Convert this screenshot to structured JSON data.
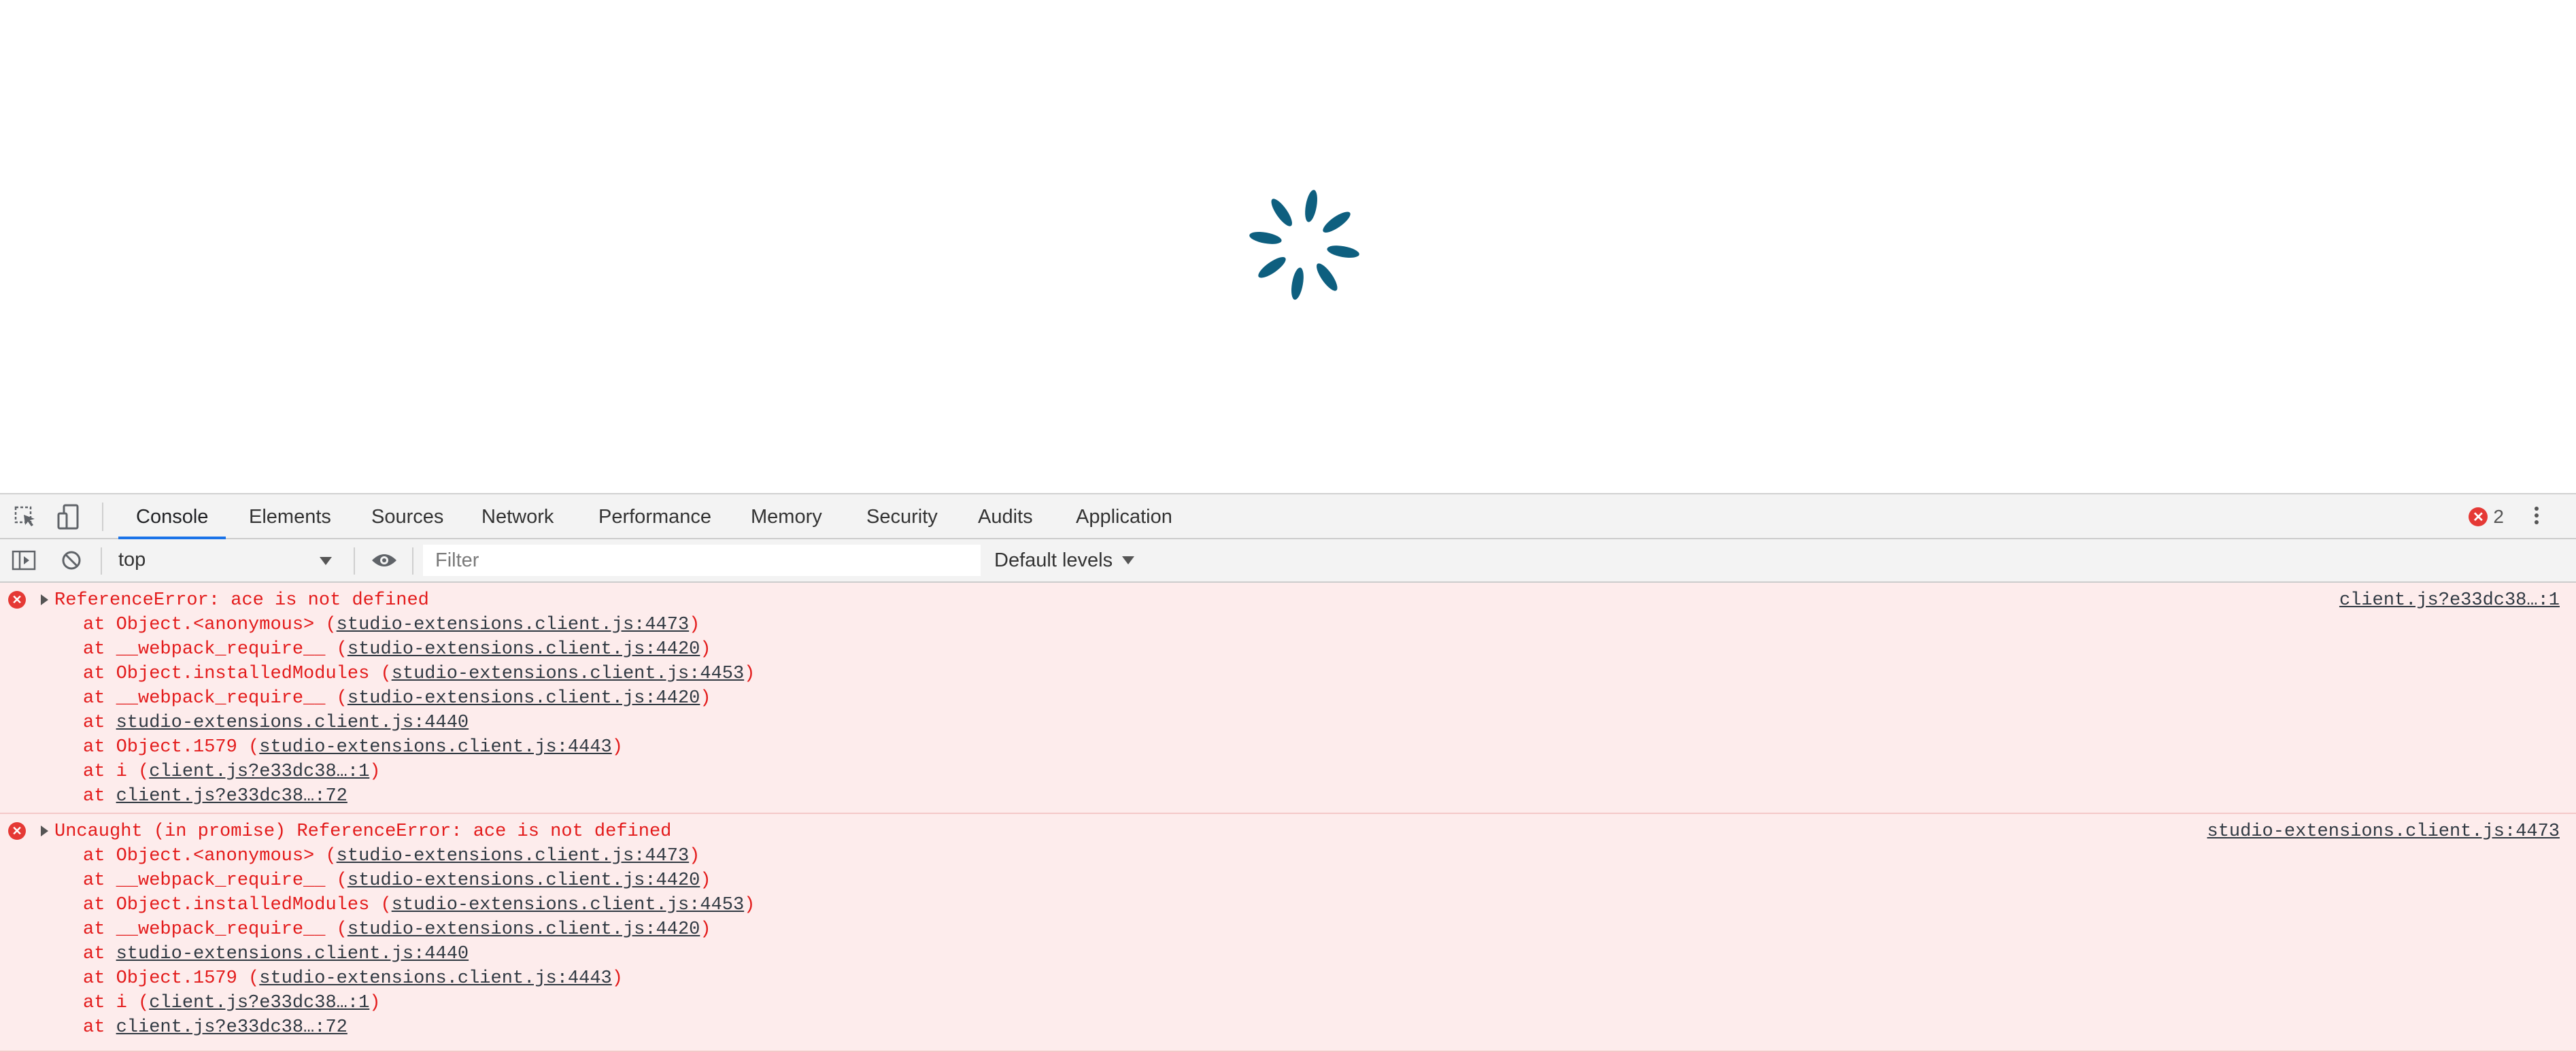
{
  "devtools": {
    "tabs": [
      "Console",
      "Elements",
      "Sources",
      "Network",
      "Performance",
      "Memory",
      "Security",
      "Audits",
      "Application"
    ],
    "error_count": "2",
    "toolbar": {
      "context": "top",
      "filter_placeholder": "Filter",
      "levels": "Default levels"
    }
  },
  "console": {
    "messages": [
      {
        "text": "ReferenceError: ace is not defined",
        "source": "client.js?e33dc38…:1",
        "stack": [
          {
            "pre": "at Object.<anonymous> (",
            "link": "studio-extensions.client.js:4473",
            "post": ")"
          },
          {
            "pre": "at __webpack_require__ (",
            "link": "studio-extensions.client.js:4420",
            "post": ")"
          },
          {
            "pre": "at Object.installedModules (",
            "link": "studio-extensions.client.js:4453",
            "post": ")"
          },
          {
            "pre": "at __webpack_require__ (",
            "link": "studio-extensions.client.js:4420",
            "post": ")"
          },
          {
            "pre": "at ",
            "link": "studio-extensions.client.js:4440",
            "post": ""
          },
          {
            "pre": "at Object.1579 (",
            "link": "studio-extensions.client.js:4443",
            "post": ")"
          },
          {
            "pre": "at i (",
            "link": "client.js?e33dc38…:1",
            "post": ")"
          },
          {
            "pre": "at ",
            "link": "client.js?e33dc38…:72",
            "post": ""
          }
        ]
      },
      {
        "text": "Uncaught (in promise) ReferenceError: ace is not defined",
        "source": "studio-extensions.client.js:4473",
        "stack": [
          {
            "pre": "at Object.<anonymous> (",
            "link": "studio-extensions.client.js:4473",
            "post": ")"
          },
          {
            "pre": "at __webpack_require__ (",
            "link": "studio-extensions.client.js:4420",
            "post": ")"
          },
          {
            "pre": "at Object.installedModules (",
            "link": "studio-extensions.client.js:4453",
            "post": ")"
          },
          {
            "pre": "at __webpack_require__ (",
            "link": "studio-extensions.client.js:4420",
            "post": ")"
          },
          {
            "pre": "at ",
            "link": "studio-extensions.client.js:4440",
            "post": ""
          },
          {
            "pre": "at Object.1579 (",
            "link": "studio-extensions.client.js:4443",
            "post": ")"
          },
          {
            "pre": "at i (",
            "link": "client.js?e33dc38…:1",
            "post": ")"
          },
          {
            "pre": "at ",
            "link": "client.js?e33dc38…:72",
            "post": ""
          }
        ]
      }
    ]
  },
  "colors": {
    "spinner": "#0e5f7f",
    "error_text": "#e31b1b",
    "error_bg": "#fdecec",
    "active_tab_underline": "#1a73e8"
  },
  "icons": [
    "inspect-element-icon",
    "device-toolbar-icon",
    "sidebar-toggle-icon",
    "clear-console-icon",
    "eye-icon",
    "error-icon",
    "kebab-menu-icon",
    "loading-spinner-icon"
  ]
}
